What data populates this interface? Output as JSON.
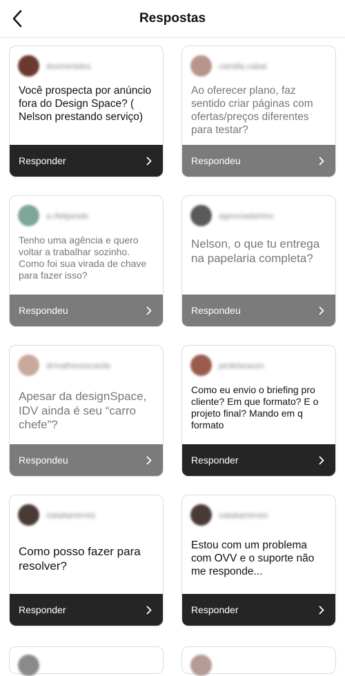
{
  "header": {
    "title": "Respostas",
    "back_icon": "chevron-left-icon"
  },
  "colors": {
    "pending_bar": "#252525",
    "answered_bar": "#7b7b7b"
  },
  "cards": [
    {
      "username": "dxxmentdes",
      "question": "Você prospecta por anúncio fora do Design Space? ( Nelson prestando serviço)",
      "status": "Responder",
      "answered": false,
      "avatar_color": "#6b3a2e"
    },
    {
      "username": "camilla.cabal",
      "question": "Ao oferecer plano, faz sentido criar páginas com ofertas/preços diferentes para testar?",
      "status": "Respondeu",
      "answered": true,
      "avatar_color": "#b8958a"
    },
    {
      "username": "a.rfelipesds",
      "question": "Tenho uma agência e quero voltar a trabalhar sozinho. Como foi sua virada de chave para fazer isso?",
      "status": "Respondeu",
      "answered": true,
      "avatar_color": "#7fa69a"
    },
    {
      "username": "agenciadartmo",
      "question": "Nelson, o que tu entrega na papelaria completa?",
      "status": "Respondeu",
      "answered": true,
      "avatar_color": "#5a5a5a"
    },
    {
      "username": "drmatheusscarda",
      "question": "Apesar da designSpace, IDV ainda é seu “carro chefe”?",
      "status": "Respondeu",
      "answered": true,
      "avatar_color": "#c9a99c"
    },
    {
      "username": "jardelarauzo",
      "question": "Como eu envio o briefing pro cliente? Em que formato? E o projeto final? Mando em q formato",
      "status": "Responder",
      "answered": false,
      "avatar_color": "#9b5b4c"
    },
    {
      "username": "nataliamirreis",
      "question": "Como posso fazer para resolver?",
      "status": "Responder",
      "answered": false,
      "avatar_color": "#4a3a35"
    },
    {
      "username": "nataliamirreis",
      "question": "Estou com um problema com OVV e o suporte não me responde...",
      "status": "Responder",
      "answered": false,
      "avatar_color": "#4a3a35"
    }
  ],
  "partial_cards": [
    {
      "avatar_color": "#8a8a8a"
    },
    {
      "avatar_color": "#b59a95"
    }
  ]
}
